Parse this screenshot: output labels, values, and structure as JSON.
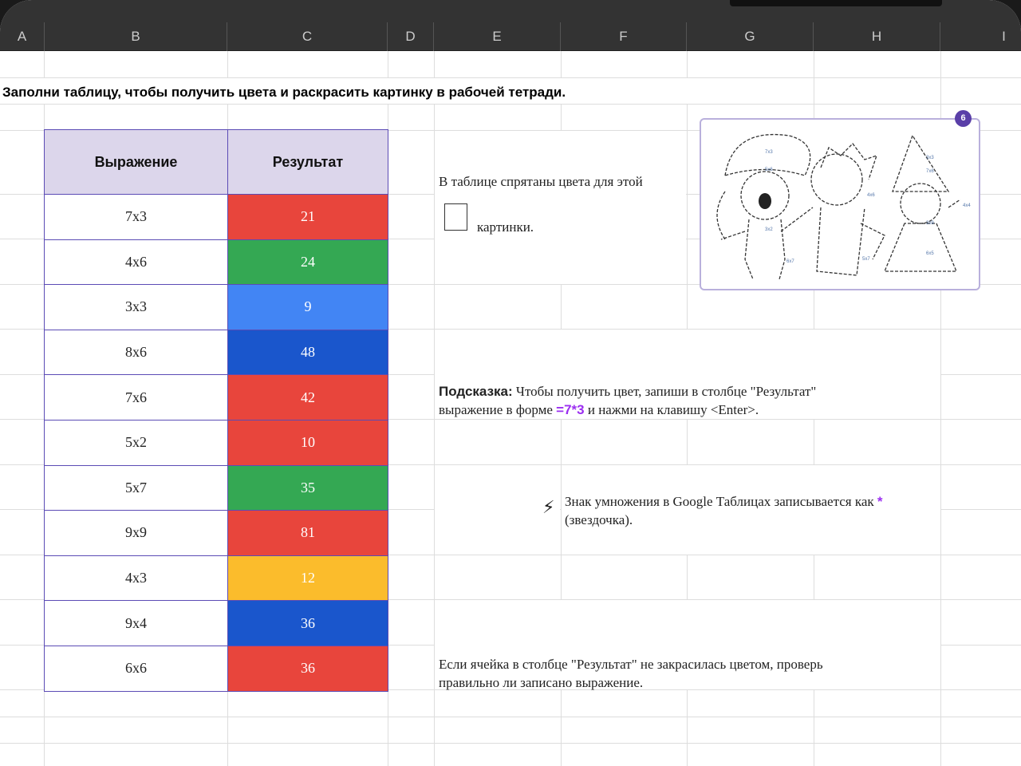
{
  "columns": [
    "A",
    "B",
    "C",
    "D",
    "E",
    "F",
    "G",
    "H",
    "I"
  ],
  "title": "Заполни таблицу, чтобы получить цвета и раскрасить картинку в рабочей тетради.",
  "table": {
    "headers": [
      "Выражение",
      "Результат"
    ],
    "rows": [
      {
        "expr": "7x3",
        "result": "21",
        "color": "#e8453c"
      },
      {
        "expr": "4x6",
        "result": "24",
        "color": "#34a853"
      },
      {
        "expr": "3x3",
        "result": "9",
        "color": "#4285f4"
      },
      {
        "expr": "8x6",
        "result": "48",
        "color": "#1a56cc"
      },
      {
        "expr": "7x6",
        "result": "42",
        "color": "#e8453c"
      },
      {
        "expr": "5x2",
        "result": "10",
        "color": "#e8453c"
      },
      {
        "expr": "5x7",
        "result": "35",
        "color": "#34a853"
      },
      {
        "expr": "9x9",
        "result": "81",
        "color": "#e8453c"
      },
      {
        "expr": "4x3",
        "result": "12",
        "color": "#fbbc2c"
      },
      {
        "expr": "9x4",
        "result": "36",
        "color": "#1a56cc"
      },
      {
        "expr": "6x6",
        "result": "36",
        "color": "#e8453c"
      }
    ]
  },
  "intro": {
    "line1": "В таблице спрятаны цвета для этой",
    "line2": "картинки."
  },
  "picture": {
    "badge": "6",
    "labels": [
      "7x3",
      "5x6",
      "3x2",
      "6x7",
      "4x6",
      "5x7",
      "3x3",
      "7x6",
      "4x4",
      "3x9",
      "6x5"
    ]
  },
  "hint": {
    "label": "Подсказка:",
    "text1": "Чтобы получить цвет, запиши в столбце \"Результат\"",
    "text2a": "выражение в форме",
    "formula": "=7*3",
    "text2b": "и нажми на клавишу <Enter>."
  },
  "note": {
    "icon": "lightning-icon",
    "text": "Знак умножения в Google Таблицах записывается как",
    "star": "*",
    "text2": "(звездочка)."
  },
  "check": {
    "text1": "Если ячейка в столбце \"Результат\" не закрасилась цветом, проверь",
    "text2": "правильно ли записано выражение."
  },
  "accent": "#9b2ff0"
}
